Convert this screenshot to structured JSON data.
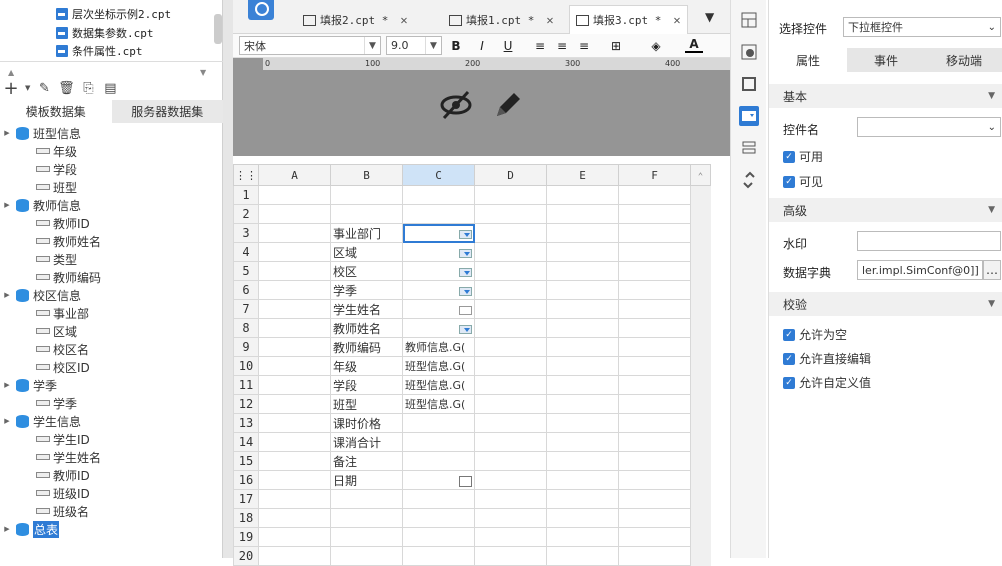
{
  "file_list": [
    "层次坐标示例2.cpt",
    "数据集参数.cpt",
    "条件属性.cpt"
  ],
  "dataset_tabs": [
    "模板数据集",
    "服务器数据集"
  ],
  "tree": [
    {
      "name": "班型信息",
      "fields": [
        "年级",
        "学段",
        "班型"
      ]
    },
    {
      "name": "教师信息",
      "fields": [
        "教师ID",
        "教师姓名",
        "类型",
        "教师编码"
      ]
    },
    {
      "name": "校区信息",
      "fields": [
        "事业部",
        "区域",
        "校区名",
        "校区ID"
      ]
    },
    {
      "name": "学季",
      "fields": [
        "学季"
      ]
    },
    {
      "name": "学生信息",
      "fields": [
        "学生ID",
        "学生姓名",
        "教师ID",
        "班级ID",
        "班级名"
      ]
    },
    {
      "name": "总表",
      "fields": []
    }
  ],
  "tabs": [
    {
      "label": "填报2.cpt *",
      "close": "✕"
    },
    {
      "label": "填报1.cpt *",
      "close": "✕"
    },
    {
      "label": "填报3.cpt *",
      "close": "✕"
    }
  ],
  "format": {
    "font": "宋体",
    "size": "9.0"
  },
  "ruler": [
    "0",
    "100",
    "200",
    "300",
    "400"
  ],
  "grid": {
    "columns": [
      "A",
      "B",
      "C",
      "D",
      "E",
      "F"
    ],
    "rows": [
      {
        "n": "1",
        "b": "",
        "c": "",
        "w": ""
      },
      {
        "n": "2",
        "b": "",
        "c": "",
        "w": ""
      },
      {
        "n": "3",
        "b": "事业部门",
        "c": "",
        "w": "combo"
      },
      {
        "n": "4",
        "b": "区域",
        "c": "",
        "w": "combo"
      },
      {
        "n": "5",
        "b": "校区",
        "c": "",
        "w": "combo"
      },
      {
        "n": "6",
        "b": "学季",
        "c": "",
        "w": "combo"
      },
      {
        "n": "7",
        "b": "学生姓名",
        "c": "",
        "w": "text"
      },
      {
        "n": "8",
        "b": "教师姓名",
        "c": "",
        "w": "combo"
      },
      {
        "n": "9",
        "b": "教师编码",
        "c": "教师信息.G(",
        "w": ""
      },
      {
        "n": "10",
        "b": "年级",
        "c": "班型信息.G(",
        "w": ""
      },
      {
        "n": "11",
        "b": "学段",
        "c": "班型信息.G(",
        "w": ""
      },
      {
        "n": "12",
        "b": "班型",
        "c": "班型信息.G(",
        "w": ""
      },
      {
        "n": "13",
        "b": "课时价格",
        "c": "",
        "w": ""
      },
      {
        "n": "14",
        "b": "课消合计",
        "c": "",
        "w": ""
      },
      {
        "n": "15",
        "b": "备注",
        "c": "",
        "w": ""
      },
      {
        "n": "16",
        "b": "日期",
        "c": "",
        "w": "date"
      },
      {
        "n": "17",
        "b": "",
        "c": "",
        "w": ""
      },
      {
        "n": "18",
        "b": "",
        "c": "",
        "w": ""
      },
      {
        "n": "19",
        "b": "",
        "c": "",
        "w": ""
      },
      {
        "n": "20",
        "b": "",
        "c": "",
        "w": ""
      }
    ]
  },
  "panel": {
    "select_label": "选择控件",
    "select_value": "下拉框控件",
    "tabs": [
      "属性",
      "事件",
      "移动端"
    ],
    "basic": "基本",
    "name_label": "控件名",
    "enabled": "可用",
    "visible": "可见",
    "advanced": "高级",
    "watermark": "水印",
    "dict_label": "数据字典",
    "dict_value": "ler.impl.SimConf@0]]",
    "dots": "…",
    "validate": "校验",
    "allow_empty": "允许为空",
    "allow_edit": "允许直接编辑",
    "allow_custom": "允许自定义值"
  },
  "accent": "#2f7bd4"
}
